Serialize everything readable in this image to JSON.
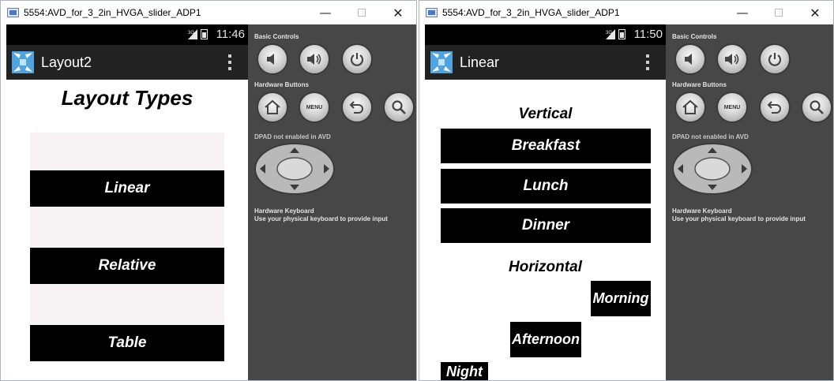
{
  "colors": {
    "statusbar": "#000000",
    "actionbar": "#222222",
    "controls_panel": "#474747",
    "block": "#000000",
    "pale_block": "#f7f2f4"
  },
  "windows": [
    {
      "title": "5554:AVD_for_3_2in_HVGA_slider_ADP1",
      "caption": {
        "minimize": "—",
        "close": "✕"
      },
      "status": {
        "network": "3G",
        "time": "11:46"
      },
      "actionbar": {
        "title": "Layout2"
      },
      "content": {
        "heading": "Layout Types",
        "buttons": [
          "Linear",
          "Relative",
          "Table"
        ]
      },
      "controls": {
        "basic_label": "Basic Controls",
        "hardware_label": "Hardware Buttons",
        "menu_label": "MENU",
        "dpad_label": "DPAD not enabled in AVD",
        "keyboard_label": "Hardware Keyboard",
        "keyboard_hint": "Use your physical keyboard to provide input"
      }
    },
    {
      "title": "5554:AVD_for_3_2in_HVGA_slider_ADP1",
      "caption": {
        "minimize": "—",
        "close": "✕"
      },
      "status": {
        "network": "3G",
        "time": "11:50"
      },
      "actionbar": {
        "title": "Linear"
      },
      "content": {
        "vertical_heading": "Vertical",
        "vertical_items": [
          "Breakfast",
          "Lunch",
          "Dinner"
        ],
        "horizontal_heading": "Horizontal",
        "horizontal_items": [
          "Morning",
          "Afternoon",
          "Night"
        ]
      },
      "controls": {
        "basic_label": "Basic Controls",
        "hardware_label": "Hardware Buttons",
        "menu_label": "MENU",
        "dpad_label": "DPAD not enabled in AVD",
        "keyboard_label": "Hardware Keyboard",
        "keyboard_hint": "Use your physical keyboard to provide input"
      }
    }
  ]
}
